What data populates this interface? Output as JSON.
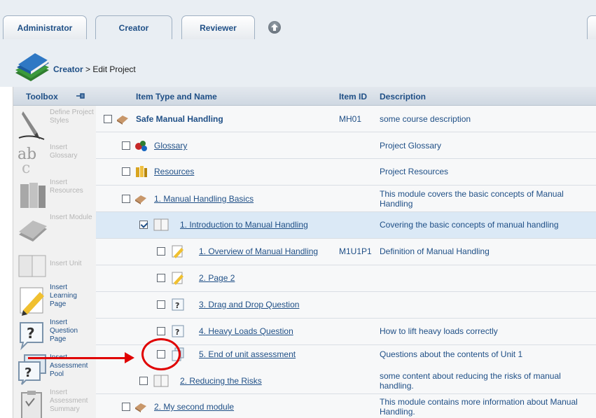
{
  "tabs": {
    "administrator": "Administrator",
    "creator": "Creator",
    "reviewer": "Reviewer"
  },
  "breadcrumb": {
    "section": "Creator",
    "separator": " > ",
    "page": "Edit Project"
  },
  "toolbox": {
    "title": "Toolbox",
    "tools": [
      {
        "label": "Define Project Styles",
        "icon": "pen-nib-icon",
        "enabled": false
      },
      {
        "label": "Insert Glossary",
        "icon": "abc-icon",
        "enabled": false
      },
      {
        "label": "Insert Resources",
        "icon": "binders-icon",
        "enabled": false
      },
      {
        "label": "Insert Module",
        "icon": "book-icon",
        "enabled": false
      },
      {
        "label": "Insert Unit",
        "icon": "open-book-icon",
        "enabled": false
      },
      {
        "label": "Insert Learning Page",
        "icon": "pencil-page-icon",
        "enabled": true
      },
      {
        "label": "Insert Question Page",
        "icon": "question-bubble-icon",
        "enabled": true
      },
      {
        "label": "Insert Assessment Pool",
        "icon": "question-stack-icon",
        "enabled": true
      },
      {
        "label": "Insert Assessment Summary",
        "icon": "clipboard-icon",
        "enabled": false
      }
    ]
  },
  "table": {
    "columns": {
      "name": "Item Type and Name",
      "id": "Item ID",
      "description": "Description"
    },
    "rows": [
      {
        "name": "Safe Manual Handling",
        "id": "MH01",
        "description": "some course description",
        "icon": "course-icon",
        "checked": false
      },
      {
        "name": "Glossary",
        "id": "",
        "description": "Project Glossary",
        "icon": "glossary-icon",
        "checked": false
      },
      {
        "name": "Resources",
        "id": "",
        "description": "Project Resources",
        "icon": "resources-icon",
        "checked": false
      },
      {
        "name": "1. Manual Handling Basics",
        "id": "",
        "description": "This module covers the basic concepts of Manual Handling",
        "icon": "module-icon",
        "checked": false
      },
      {
        "name": "1. Introduction to Manual Handling",
        "id": "",
        "description": "Covering the basic concepts of manual handling",
        "icon": "unit-icon",
        "checked": true
      },
      {
        "name": "1. Overview of Manual Handling",
        "id": "M1U1P1",
        "description": "Definition of Manual Handling",
        "icon": "learning-page-icon",
        "checked": false
      },
      {
        "name": "2. Page 2",
        "id": "",
        "description": "",
        "icon": "learning-page-icon",
        "checked": false
      },
      {
        "name": "3. Drag and Drop Question",
        "id": "",
        "description": "",
        "icon": "question-page-icon",
        "checked": false
      },
      {
        "name": "4. Heavy Loads Question",
        "id": "",
        "description": "How to lift heavy loads correctly",
        "icon": "question-page-icon",
        "checked": false
      },
      {
        "name": "5. End of unit assessment",
        "id": "",
        "description": "Questions about the contents of Unit 1",
        "icon": "assessment-icon",
        "checked": false
      },
      {
        "name": "2. Reducing the Risks",
        "id": "",
        "description": "some content about reducing the risks of manual handling.",
        "icon": "unit-icon",
        "checked": false
      },
      {
        "name": "2. My second module",
        "id": "",
        "description": "This module contains more information about Manual Handling.",
        "icon": "module-icon",
        "checked": false
      }
    ]
  },
  "colors": {
    "link": "#1f4f86",
    "annotation": "#e00000",
    "selected_row": "#dbe9f6"
  }
}
